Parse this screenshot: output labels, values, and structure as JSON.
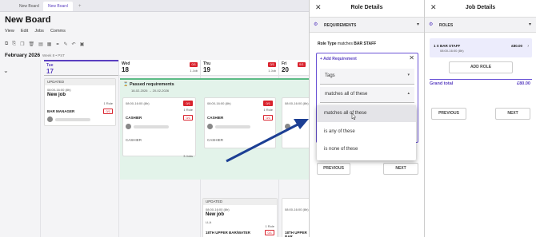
{
  "tabs": [
    {
      "label": "New Board"
    },
    {
      "label": "New Board"
    },
    {
      "label": "+"
    }
  ],
  "board": {
    "title": "New Board",
    "menu": [
      "View",
      "Edit",
      "Jobs",
      "Comms"
    ],
    "month": "February 2026",
    "week": "Week 8 • PST"
  },
  "days": [
    {
      "name": "Tue",
      "num": "17",
      "badge": "0/1",
      "jobs": "1 Job"
    },
    {
      "name": "Wed",
      "num": "18",
      "badge": "0/1",
      "jobs": "1 Job"
    },
    {
      "name": "Thu",
      "num": "19",
      "badge": "0/1",
      "jobs": "1 Job"
    },
    {
      "name": "Fri",
      "num": "20",
      "badge": "0/1",
      "jobs": ""
    }
  ],
  "cards": {
    "tue": {
      "band": "UPDATED",
      "time": "08:00-16:00 (8h)",
      "name": "New job",
      "roles": "1 Role",
      "role": "BAR MANAGER",
      "fill": "0/1"
    },
    "wed": {
      "time": "08:00-16:00 (8h)",
      "roles": "1 Role",
      "role": "CASHIER",
      "fill": "0/1",
      "fill_top": "0/1",
      "foot": "CASHIER",
      "shifts": "3 Jobs"
    },
    "thu": {
      "time": "08:00-16:00 (8h)",
      "roles": "1 Role",
      "role": "CASHIER",
      "fill": "0/1",
      "fill_top": "0/1",
      "foot": "CASHIER"
    },
    "thu2": {
      "band": "UPDATED",
      "time": "08:00-16:00 (8h)",
      "name": "New job",
      "loc": "LLA",
      "roles": "1 Role",
      "role": "18TH UPPER BAR/WATER",
      "fill": "0/1"
    },
    "fri": {
      "time": "08:00-16:00 (8h)"
    },
    "fri2": {
      "time": "08:00-16:00 (8h)",
      "role": "18TH UPPER BAR"
    }
  },
  "passed": {
    "title": "Passed requirements",
    "dates": "18-02-2026 → 20-02-2026"
  },
  "role_panel": {
    "title": "Role Details",
    "section": "REQUIREMENTS",
    "role_type_prefix": "Role Type",
    "role_type_mid": "matches",
    "role_type_value": "BAR STAFF",
    "add_requirement": "Add Requirement",
    "field_select": "Tags",
    "match_select": "matches all of these",
    "options": [
      "matches all of these",
      "is any of these",
      "is none of these"
    ],
    "highlighted_option": 0,
    "prev_label": "PREVIOUS",
    "next_label": "NEXT"
  },
  "job_panel": {
    "title": "Job Details",
    "section": "ROLES",
    "role_qty": "1 X",
    "role_name": "BAR STAFF",
    "role_time": "08:00-16:00 (8h)",
    "role_price": "£80.00",
    "add_role": "ADD ROLE",
    "grand_total_label": "Grand total",
    "grand_total_value": "£80.00",
    "prev_label": "PREVIOUS",
    "next_label": "NEXT"
  },
  "colors": {
    "accent": "#5a3fc0",
    "alert": "#d9232e",
    "passed_bg": "#e3f3ea",
    "arrow": "#1c3f94"
  },
  "icons": [
    "close-icon",
    "requirements-icon",
    "chevron-down-icon",
    "chevron-up-icon",
    "chevron-right-icon",
    "cursor-icon",
    "roles-icon",
    "collapse-icon",
    "toolbar-icons"
  ]
}
